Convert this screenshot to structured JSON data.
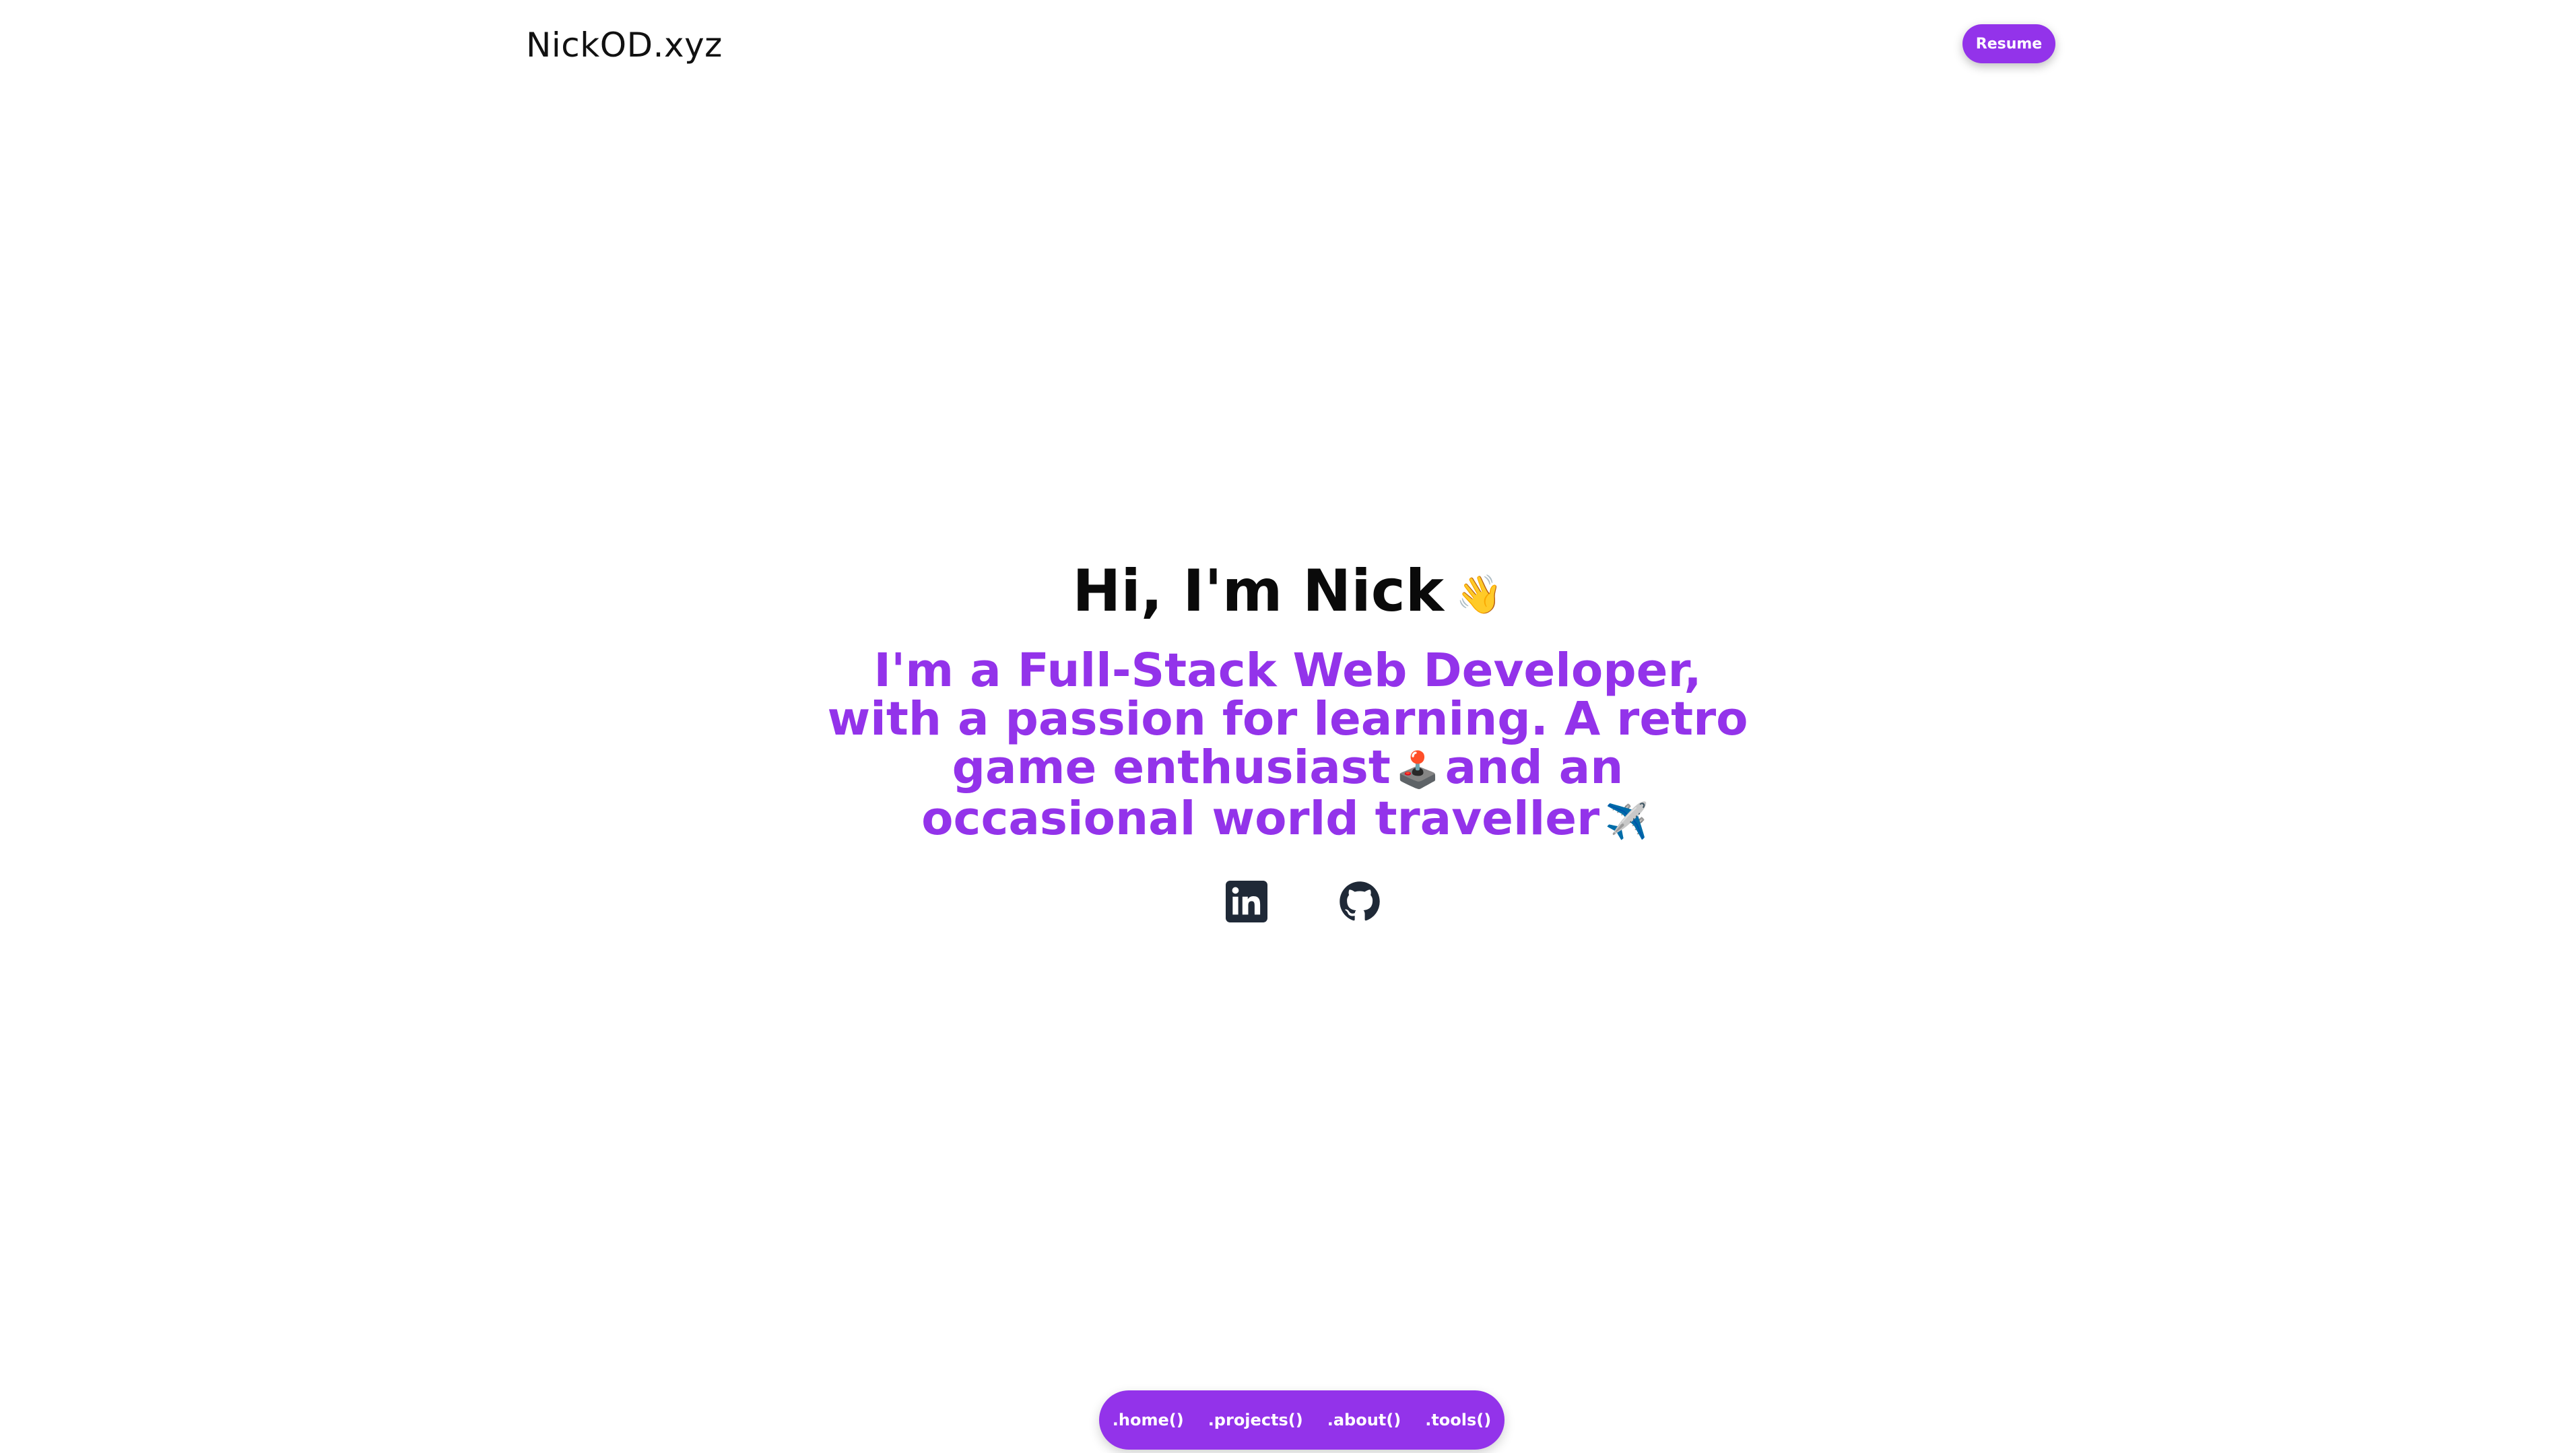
{
  "header": {
    "logo": "NickOD.xyz",
    "resume_label": "Resume"
  },
  "hero": {
    "title": "Hi, I'm Nick",
    "wave_emoji": "👋",
    "subtitle_part1": "I'm a Full-Stack Web Developer, with a passion for learning. A retro game enthusiast",
    "joystick_emoji": "🕹️",
    "subtitle_part2": "and an occasional world traveller",
    "plane_emoji": "✈️"
  },
  "socials": [
    {
      "name": "linkedin-icon"
    },
    {
      "name": "github-icon"
    }
  ],
  "nav": {
    "items": [
      {
        "label": ".home()"
      },
      {
        "label": ".projects()"
      },
      {
        "label": ".about()"
      },
      {
        "label": ".tools()"
      }
    ]
  },
  "colors": {
    "accent": "#9333ea",
    "text": "#0a0a0a",
    "icon": "#1f2937",
    "background": "#ffffff"
  }
}
